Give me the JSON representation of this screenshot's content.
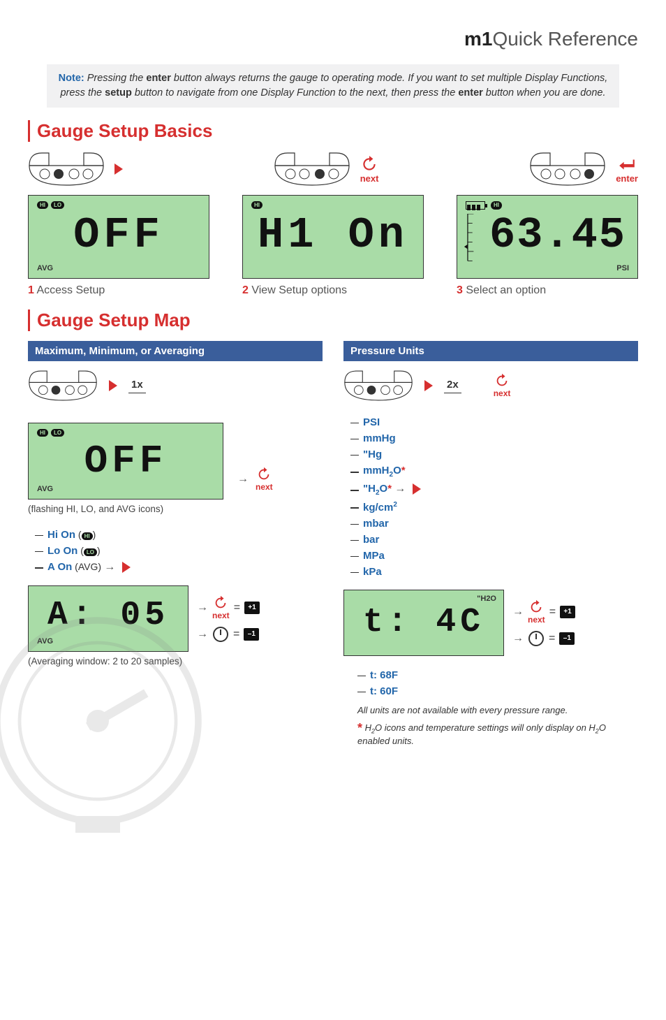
{
  "header": {
    "brand": "m1",
    "title": "Quick Reference"
  },
  "note": {
    "label": "Note:",
    "line1_a": " Pressing the ",
    "enter": "enter",
    "line1_b": " button always returns the gauge to operating mode. If you want to set multiple Display Functions, press the ",
    "setup": "setup",
    "line1_c": " button to navigate from one Display Function to the next, then press the ",
    "line1_d": " button when you are done."
  },
  "sections": {
    "basics": "Gauge Setup Basics",
    "map": "Gauge Setup Map"
  },
  "buttons": {
    "next": "next",
    "enter": "enter"
  },
  "basics": {
    "lcd1": {
      "hi": "HI",
      "lo": "LO",
      "value": "OFF",
      "avg": "AVG"
    },
    "lcd2": {
      "hi": "HI",
      "value": "H1 On"
    },
    "lcd3": {
      "hi": "HI",
      "value": "63.45",
      "unit": "PSI"
    },
    "cap1": {
      "n": "1",
      "t": " Access Setup"
    },
    "cap2": {
      "n": "2",
      "t": " View Setup options"
    },
    "cap3": {
      "n": "3",
      "t": " Select an option"
    }
  },
  "map": {
    "left": {
      "header": "Maximum, Minimum, or  Averaging",
      "times": "1x",
      "lcd": {
        "hi": "HI",
        "lo": "LO",
        "value": "OFF",
        "avg": "AVG"
      },
      "lcd_caption": "(flashing HI, LO, and AVG icons)",
      "opts": [
        {
          "label": "Hi On",
          "after": " (",
          "icon": "HI",
          "after2": ")"
        },
        {
          "label": "Lo On",
          "after": " (",
          "icon": "LO",
          "after2": ")"
        },
        {
          "label": "A  On",
          "after": " (AVG)",
          "play": true
        }
      ],
      "lcd2": {
        "value": "A: 05",
        "avg": "AVG"
      },
      "lcd2_caption": "(Averaging window: 2 to 20 samples)"
    },
    "right": {
      "header": "Pressure Units",
      "times": "2x",
      "units": [
        {
          "label": "PSI"
        },
        {
          "label": "mmHg"
        },
        {
          "label": "\"Hg"
        },
        {
          "label": "mmH",
          "sub": "2",
          "tail": "O",
          "star": true
        },
        {
          "label": "\"H",
          "sub": "2",
          "tail": "O",
          "star": true,
          "play": true
        },
        {
          "label": "kg/cm",
          "sup": "2"
        },
        {
          "label": "mbar"
        },
        {
          "label": "bar"
        },
        {
          "label": "MPa"
        },
        {
          "label": "kPa"
        }
      ],
      "lcd": {
        "value": "t: 4C",
        "unit": "\"H2O"
      },
      "t_opts": [
        "t:  68F",
        "t:  60F"
      ],
      "foot1": "All units are not available with every pressure range.",
      "foot2_a": " H",
      "foot2_b": "O icons and temperature settings will only display on H",
      "foot2_c": "O enabled units."
    }
  },
  "adjust": {
    "plus": "+1",
    "minus": "–1",
    "eq": "="
  }
}
